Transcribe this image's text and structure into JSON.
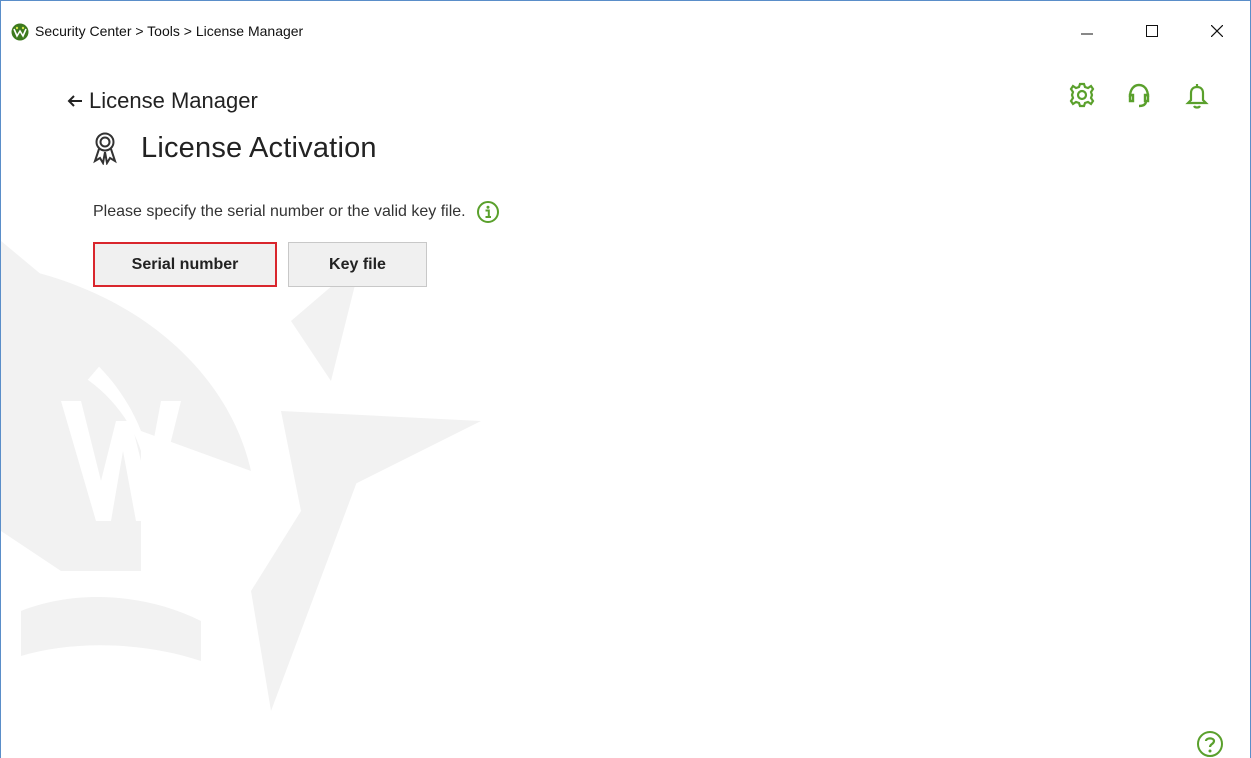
{
  "window": {
    "title": "Security Center > Tools > License Manager"
  },
  "toolbar": {
    "icons": [
      "gear-icon",
      "support-headset-icon",
      "bell-icon"
    ],
    "accent_color": "#5aa02c"
  },
  "nav": {
    "back_label": "License Manager"
  },
  "page": {
    "title": "License Activation",
    "description": "Please specify the serial number or the valid key file."
  },
  "buttons": {
    "serial_number": "Serial number",
    "key_file": "Key file",
    "highlight_color": "#d9262d"
  }
}
